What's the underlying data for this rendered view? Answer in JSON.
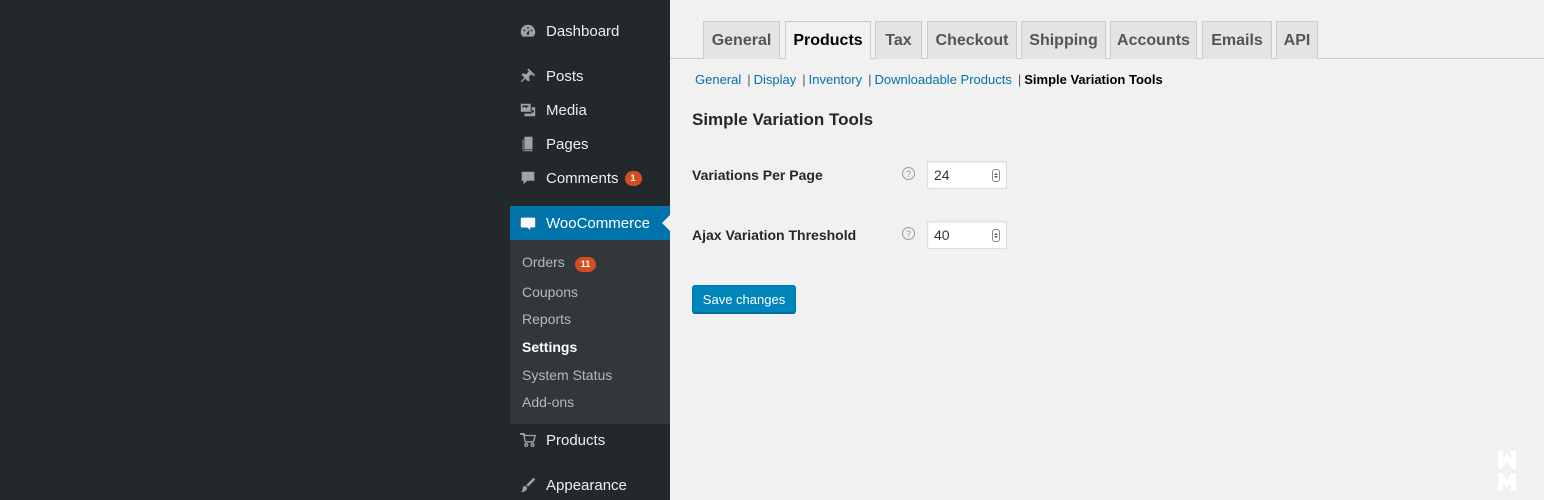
{
  "sidebar": {
    "items": [
      {
        "label": "Dashboard",
        "icon": "dashboard-icon"
      },
      {
        "label": "Posts",
        "icon": "pin-icon"
      },
      {
        "label": "Media",
        "icon": "media-icon"
      },
      {
        "label": "Pages",
        "icon": "pages-icon"
      },
      {
        "label": "Comments",
        "icon": "comment-icon",
        "badge": "1"
      },
      {
        "label": "WooCommerce",
        "icon": "woo-icon"
      },
      {
        "label": "Products",
        "icon": "cart-icon"
      },
      {
        "label": "Appearance",
        "icon": "brush-icon"
      }
    ],
    "submenu": [
      {
        "label": "Orders",
        "badge": "11"
      },
      {
        "label": "Coupons"
      },
      {
        "label": "Reports"
      },
      {
        "label": "Settings"
      },
      {
        "label": "System Status"
      },
      {
        "label": "Add-ons"
      }
    ]
  },
  "tabs": [
    "General",
    "Products",
    "Tax",
    "Checkout",
    "Shipping",
    "Accounts",
    "Emails",
    "API"
  ],
  "subsub": [
    "General",
    "Display",
    "Inventory",
    "Downloadable Products",
    "Simple Variation Tools"
  ],
  "section_title": "Simple Variation Tools",
  "fields": [
    {
      "label": "Variations Per Page",
      "value": "24"
    },
    {
      "label": "Ajax Variation Threshold",
      "value": "40"
    }
  ],
  "save_label": "Save changes",
  "colors": {
    "accent": "#0073aa",
    "button": "#0085ba",
    "badge": "#d54e21",
    "sidebar": "#23282d"
  }
}
